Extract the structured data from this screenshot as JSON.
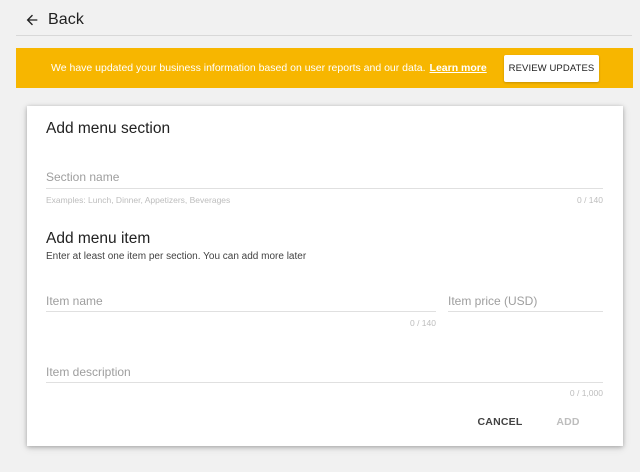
{
  "header": {
    "back_label": "Back"
  },
  "banner": {
    "message": "We have updated your business information based on user reports and our data.",
    "learn_more": "Learn more",
    "review_button": "REVIEW UPDATES",
    "color": "#f7b600"
  },
  "section": {
    "title": "Add menu section",
    "name_placeholder": "Section name",
    "name_hint": "Examples: Lunch, Dinner, Appetizers, Beverages",
    "name_counter": "0 / 140"
  },
  "item": {
    "title": "Add menu item",
    "subtitle": "Enter at least one item per section. You can add more later",
    "name_placeholder": "Item name",
    "name_counter": "0 / 140",
    "price_placeholder": "Item price (USD)",
    "description_placeholder": "Item description",
    "description_counter": "0 / 1,000"
  },
  "actions": {
    "cancel_label": "CANCEL",
    "add_label": "ADD"
  },
  "icons": {
    "back": "arrow-left-icon"
  }
}
